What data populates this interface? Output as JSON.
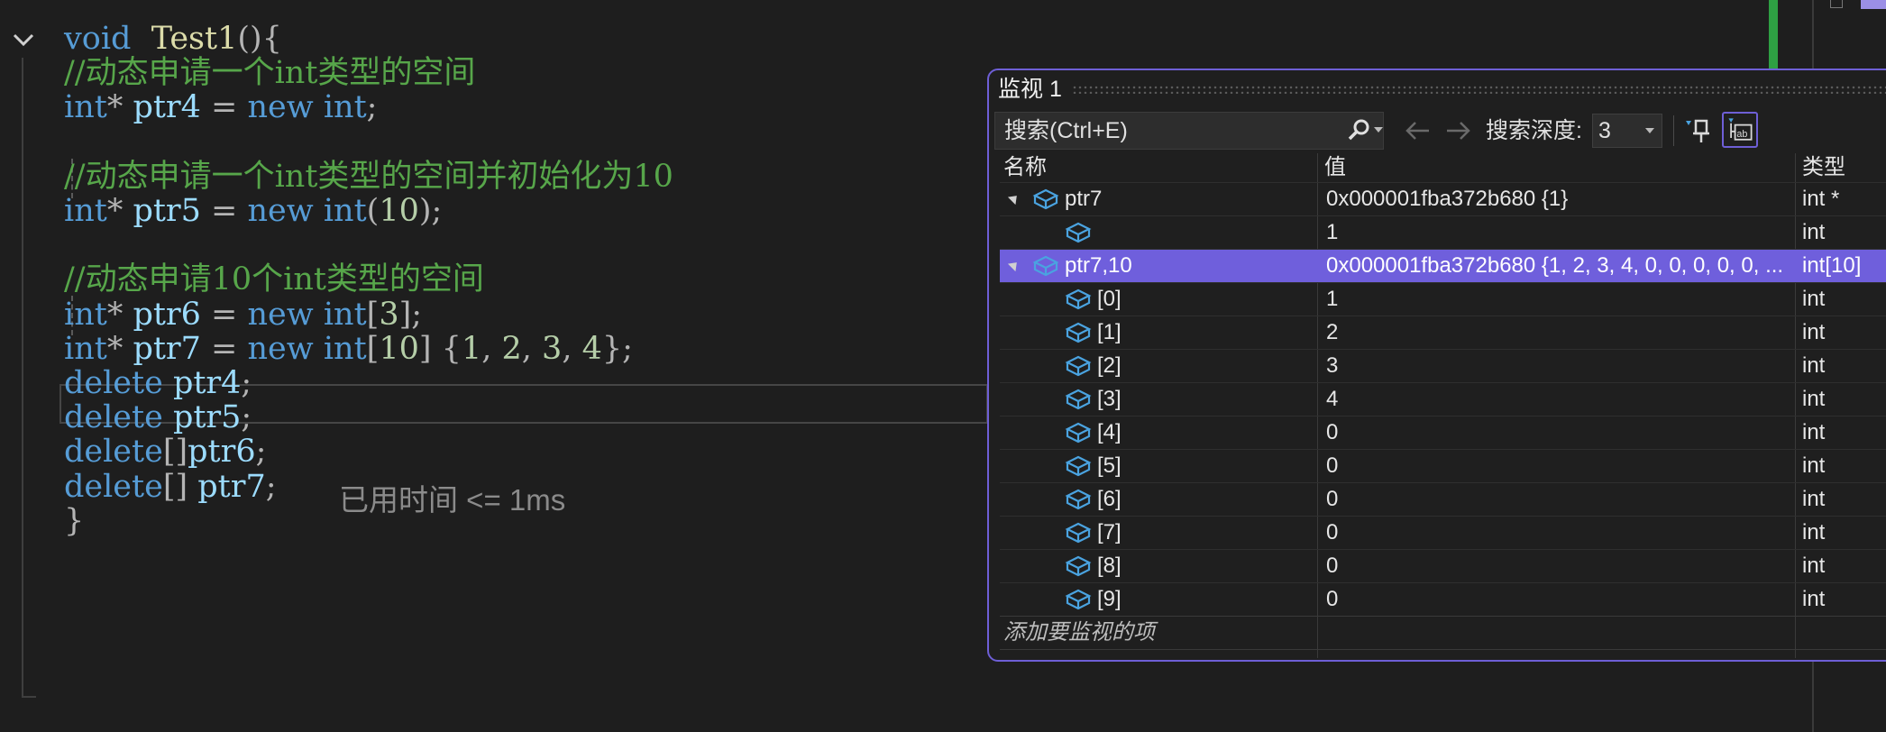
{
  "editor": {
    "lines": [
      {
        "tokens": [
          {
            "t": "void",
            "c": "kw"
          },
          {
            "t": "  ",
            "c": ""
          },
          {
            "t": "Test1",
            "c": "fn"
          },
          {
            "t": "(){",
            "c": "pu"
          }
        ]
      },
      {
        "tokens": [
          {
            "t": "//动态申请一个int类型的空间",
            "c": "cm"
          }
        ]
      },
      {
        "tokens": [
          {
            "t": "int",
            "c": "kw"
          },
          {
            "t": "* ",
            "c": "pu"
          },
          {
            "t": "ptr4",
            "c": "id"
          },
          {
            "t": " = ",
            "c": "pu"
          },
          {
            "t": "new",
            "c": "kw"
          },
          {
            "t": " ",
            "c": ""
          },
          {
            "t": "int",
            "c": "kw"
          },
          {
            "t": ";",
            "c": "pu"
          }
        ]
      },
      {
        "tokens": []
      },
      {
        "tokens": [
          {
            "t": "//动态申请一个int类型的空间并初始化为10",
            "c": "cm"
          }
        ]
      },
      {
        "tokens": [
          {
            "t": "int",
            "c": "kw"
          },
          {
            "t": "* ",
            "c": "pu"
          },
          {
            "t": "ptr5",
            "c": "id"
          },
          {
            "t": " = ",
            "c": "pu"
          },
          {
            "t": "new",
            "c": "kw"
          },
          {
            "t": " ",
            "c": ""
          },
          {
            "t": "int",
            "c": "kw"
          },
          {
            "t": "(",
            "c": "pu"
          },
          {
            "t": "10",
            "c": "nu"
          },
          {
            "t": ");",
            "c": "pu"
          }
        ]
      },
      {
        "tokens": []
      },
      {
        "tokens": [
          {
            "t": "//动态申请10个int类型的空间",
            "c": "cm"
          }
        ]
      },
      {
        "tokens": [
          {
            "t": "int",
            "c": "kw"
          },
          {
            "t": "* ",
            "c": "pu"
          },
          {
            "t": "ptr6",
            "c": "id"
          },
          {
            "t": " = ",
            "c": "pu"
          },
          {
            "t": "new",
            "c": "kw"
          },
          {
            "t": " ",
            "c": ""
          },
          {
            "t": "int",
            "c": "kw"
          },
          {
            "t": "[",
            "c": "pu"
          },
          {
            "t": "3",
            "c": "nu"
          },
          {
            "t": "];",
            "c": "pu"
          }
        ]
      },
      {
        "tokens": [
          {
            "t": "int",
            "c": "kw"
          },
          {
            "t": "* ",
            "c": "pu"
          },
          {
            "t": "ptr7",
            "c": "id"
          },
          {
            "t": " = ",
            "c": "pu"
          },
          {
            "t": "new",
            "c": "kw"
          },
          {
            "t": " ",
            "c": ""
          },
          {
            "t": "int",
            "c": "kw"
          },
          {
            "t": "[",
            "c": "pu"
          },
          {
            "t": "10",
            "c": "nu"
          },
          {
            "t": "] {",
            "c": "pu"
          },
          {
            "t": "1",
            "c": "nu"
          },
          {
            "t": ", ",
            "c": "pu"
          },
          {
            "t": "2",
            "c": "nu"
          },
          {
            "t": ", ",
            "c": "pu"
          },
          {
            "t": "3",
            "c": "nu"
          },
          {
            "t": ", ",
            "c": "pu"
          },
          {
            "t": "4",
            "c": "nu"
          },
          {
            "t": "};",
            "c": "pu"
          }
        ]
      },
      {
        "tokens": [
          {
            "t": "delete",
            "c": "kw"
          },
          {
            "t": " ",
            "c": ""
          },
          {
            "t": "ptr4",
            "c": "id"
          },
          {
            "t": ";",
            "c": "pu"
          }
        ]
      },
      {
        "tokens": [
          {
            "t": "delete",
            "c": "kw"
          },
          {
            "t": " ",
            "c": ""
          },
          {
            "t": "ptr5",
            "c": "id"
          },
          {
            "t": ";",
            "c": "pu"
          }
        ]
      },
      {
        "tokens": [
          {
            "t": "delete",
            "c": "kw"
          },
          {
            "t": "[]",
            "c": "pu"
          },
          {
            "t": "ptr6",
            "c": "id"
          },
          {
            "t": ";",
            "c": "pu"
          }
        ]
      },
      {
        "tokens": [
          {
            "t": "delete",
            "c": "kw"
          },
          {
            "t": "[] ",
            "c": "pu"
          },
          {
            "t": "ptr7",
            "c": "id"
          },
          {
            "t": ";",
            "c": "pu"
          }
        ]
      },
      {
        "tokens": [
          {
            "t": "}",
            "c": "pu"
          }
        ]
      }
    ],
    "elapsed_hint": "已用时间 <= 1ms"
  },
  "watch": {
    "title": "监视 1",
    "search_placeholder": "搜索(Ctrl+E)",
    "depth_label": "搜索深度:",
    "depth_value": "3",
    "columns": {
      "name": "名称",
      "value": "值",
      "type": "类型"
    },
    "rows": [
      {
        "name": "ptr7",
        "value": "0x000001fba372b680 {1}",
        "type": "int *",
        "level": 0,
        "expanded": true,
        "selected": false
      },
      {
        "name": "",
        "value": "1",
        "type": "int",
        "level": 1,
        "expanded": false,
        "selected": false
      },
      {
        "name": "ptr7,10",
        "value": "0x000001fba372b680 {1, 2, 3, 4, 0, 0, 0, 0, 0, ...",
        "type": "int[10]",
        "level": 0,
        "expanded": true,
        "selected": true
      },
      {
        "name": "[0]",
        "value": "1",
        "type": "int",
        "level": 1,
        "expanded": false,
        "selected": false
      },
      {
        "name": "[1]",
        "value": "2",
        "type": "int",
        "level": 1,
        "expanded": false,
        "selected": false
      },
      {
        "name": "[2]",
        "value": "3",
        "type": "int",
        "level": 1,
        "expanded": false,
        "selected": false
      },
      {
        "name": "[3]",
        "value": "4",
        "type": "int",
        "level": 1,
        "expanded": false,
        "selected": false
      },
      {
        "name": "[4]",
        "value": "0",
        "type": "int",
        "level": 1,
        "expanded": false,
        "selected": false
      },
      {
        "name": "[5]",
        "value": "0",
        "type": "int",
        "level": 1,
        "expanded": false,
        "selected": false
      },
      {
        "name": "[6]",
        "value": "0",
        "type": "int",
        "level": 1,
        "expanded": false,
        "selected": false
      },
      {
        "name": "[7]",
        "value": "0",
        "type": "int",
        "level": 1,
        "expanded": false,
        "selected": false
      },
      {
        "name": "[8]",
        "value": "0",
        "type": "int",
        "level": 1,
        "expanded": false,
        "selected": false
      },
      {
        "name": "[9]",
        "value": "0",
        "type": "int",
        "level": 1,
        "expanded": false,
        "selected": false
      }
    ],
    "add_item_label": "添加要监视的项"
  },
  "icons": {
    "fold": "chevron-down-icon",
    "search": "search-icon",
    "back": "arrow-left-icon",
    "forward": "arrow-right-icon",
    "pin": "pin-icon",
    "hex": "hex-display-icon",
    "variable": "variable-icon"
  },
  "colors": {
    "editor_bg": "#1e1e1e",
    "keyword": "#569cd6",
    "comment": "#57a64a",
    "identifier": "#9cdcfe",
    "function": "#dcdcaa",
    "number": "#b5cea8",
    "watch_accent": "#6f5fdc",
    "variable_icon": "#4aa3e0"
  }
}
